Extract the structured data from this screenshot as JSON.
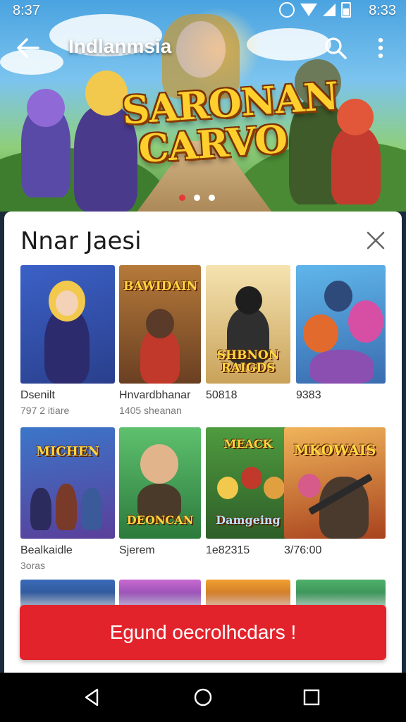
{
  "status_bar": {
    "time_left": "8:37",
    "time_right": "8:33"
  },
  "app_bar": {
    "title": "Indlanmsia"
  },
  "hero": {
    "title_line1": "SARONAN",
    "title_line2": "CARVO",
    "slides": 3,
    "active_slide": 1
  },
  "sheet": {
    "title": "Nnar Jaesi",
    "row1": [
      {
        "name": "Dsenilt",
        "sub": "797 2 itiare",
        "art_text": "",
        "bg": "#3b61c7"
      },
      {
        "name": "Hnvardbhanar",
        "sub": "1405 sheanan",
        "art_text": "BAWIDAIN",
        "bg": "#7a4a2a"
      },
      {
        "name": "50818",
        "sub": "",
        "art_text": "SHBNON RAIGDS",
        "bg": "#e8d39a"
      },
      {
        "name": "9383",
        "sub": "",
        "art_text": "",
        "bg": "#4fa7de"
      }
    ],
    "row2": [
      {
        "name": "Bealkaidle",
        "sub": "3oras",
        "art_text": "MICHEN",
        "bg": "#2d4aa8"
      },
      {
        "name": "Sjerem",
        "sub": "",
        "art_text": "DEONCAN",
        "bg": "#3a9a5a"
      },
      {
        "name": "1e82315",
        "sub": "",
        "art_text": "Damgeing",
        "bg": "#3a7a3a"
      },
      {
        "name": "3/76:00",
        "sub": "",
        "art_text": "MKOWAIS",
        "bg": "#c0502a"
      }
    ]
  },
  "cta": {
    "label": "Egund oecrolhcdars !"
  },
  "colors": {
    "accent": "#e3232b",
    "dot_active": "#e53935"
  }
}
